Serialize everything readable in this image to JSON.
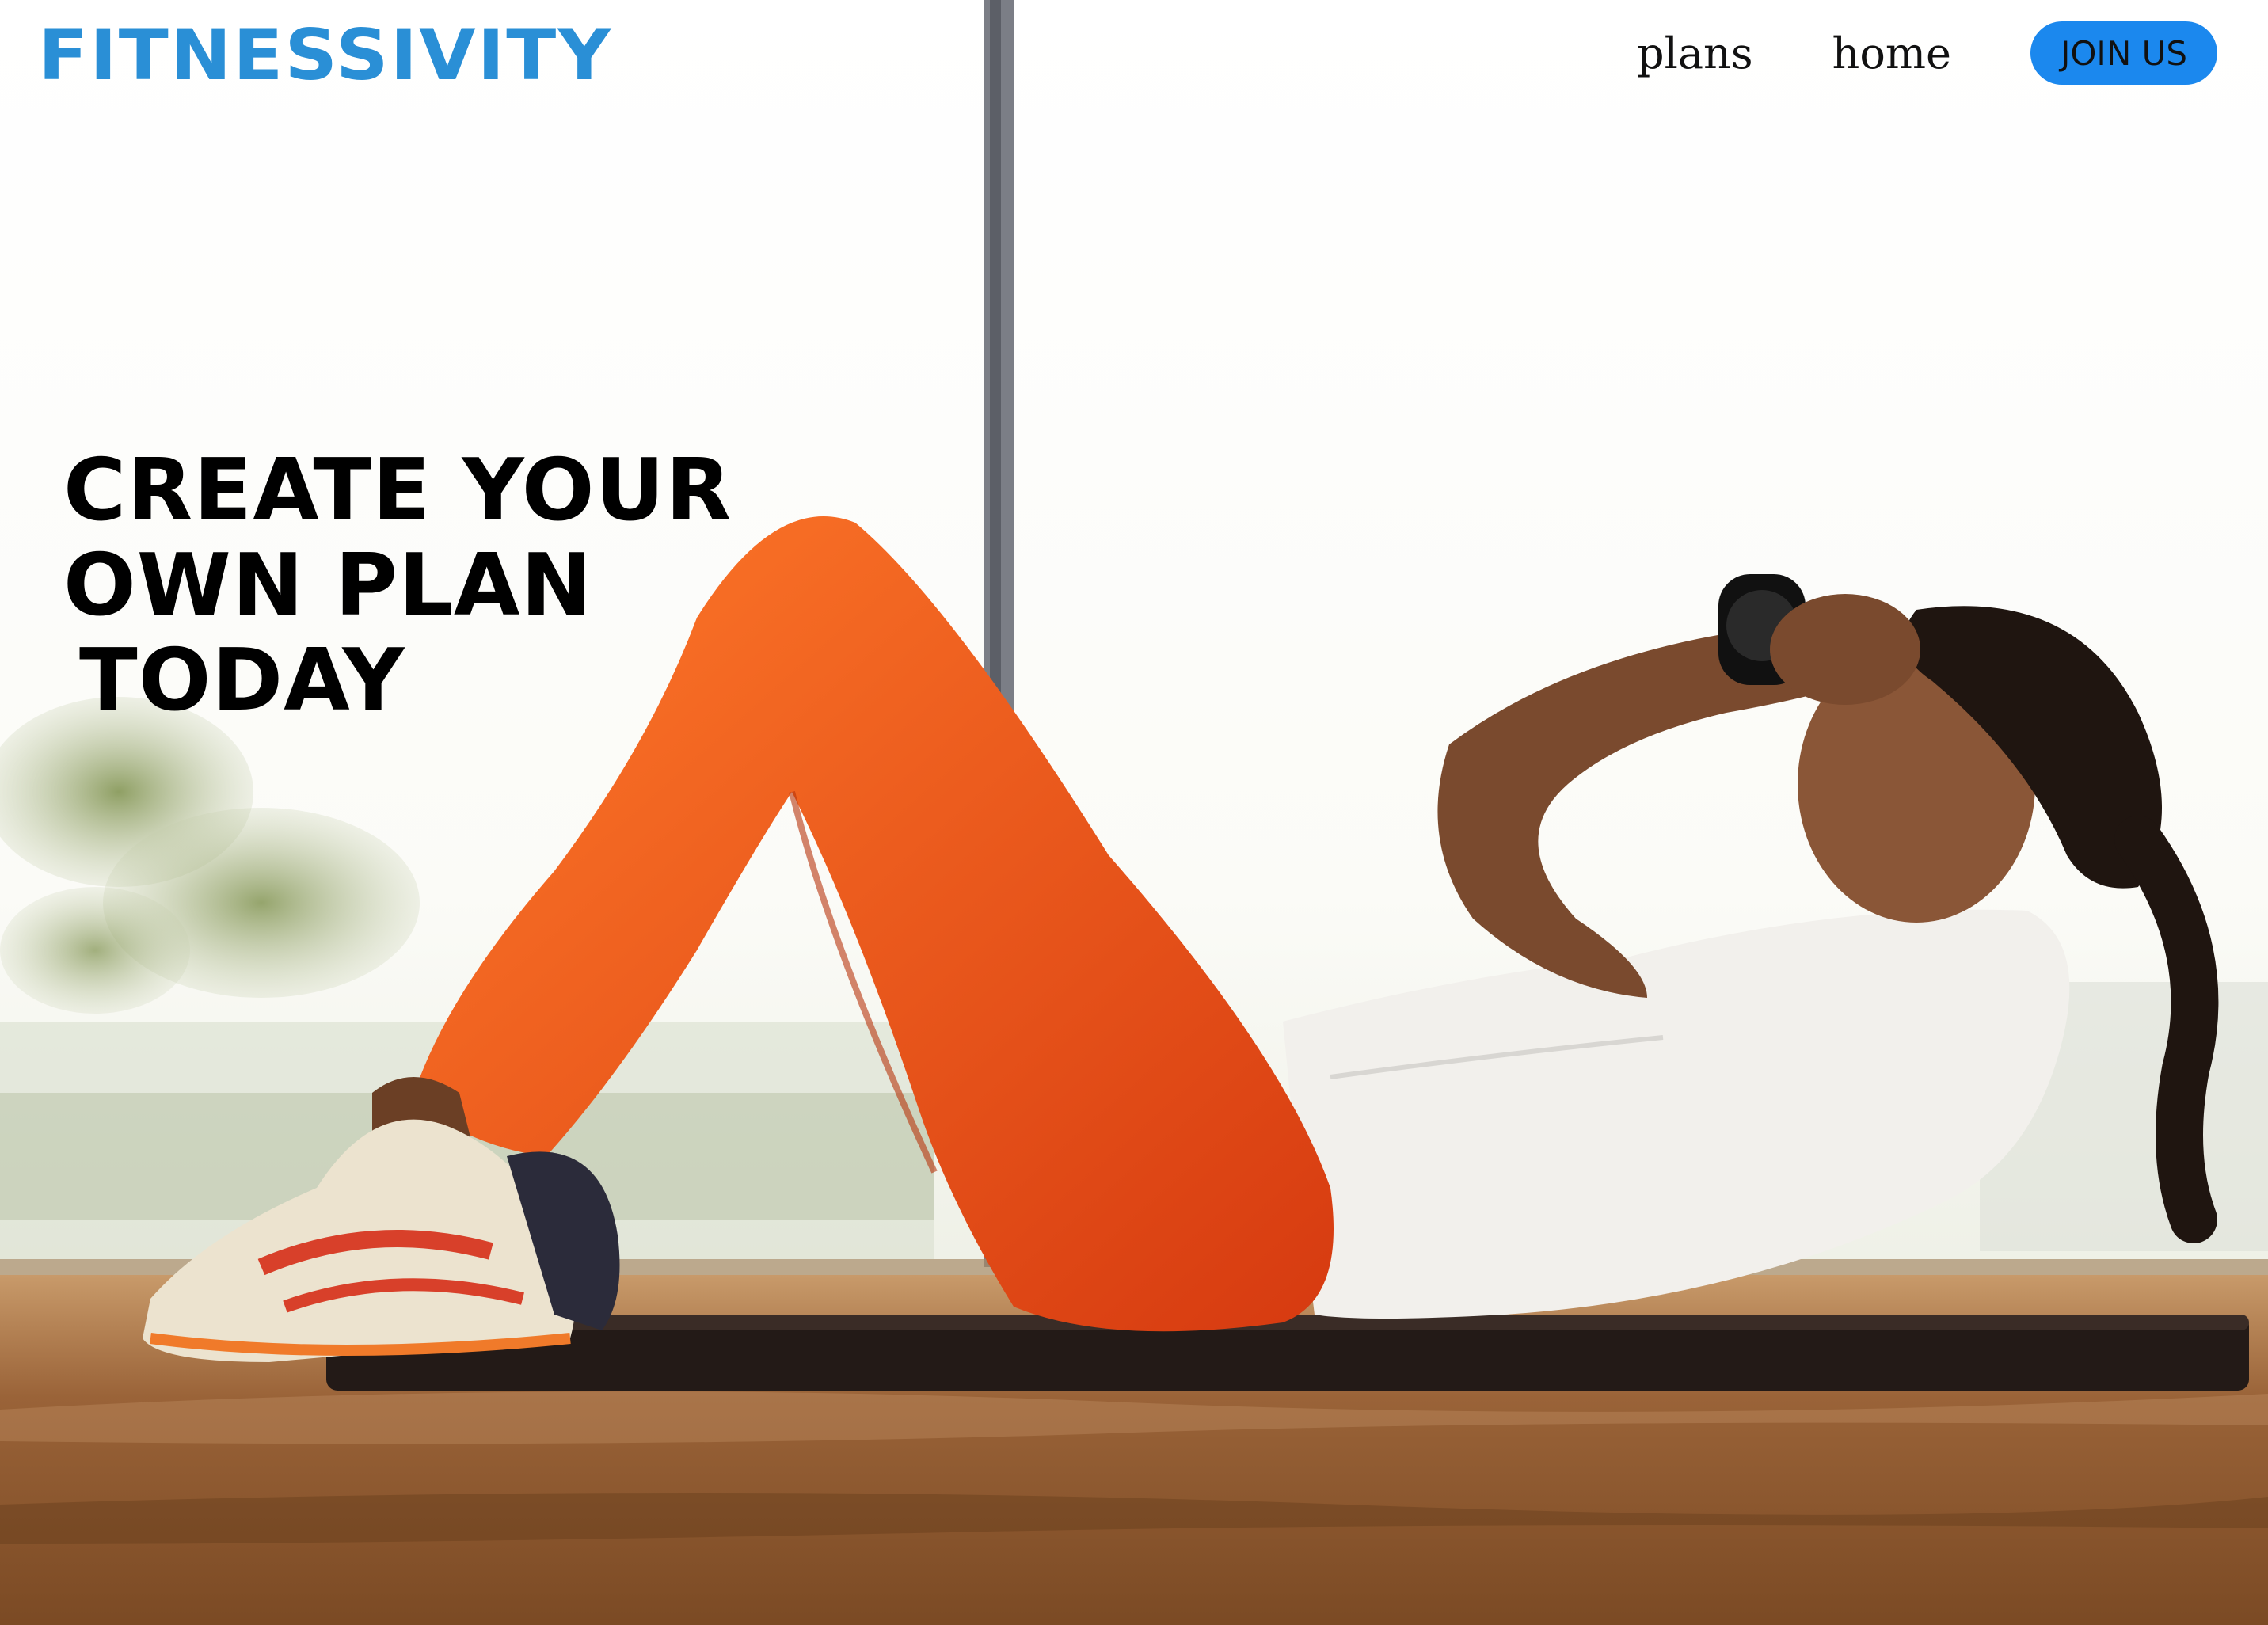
{
  "header": {
    "brand": "Fitnessivity",
    "nav": {
      "plans": "plans",
      "home": "home",
      "join": "JOIN US"
    }
  },
  "hero": {
    "headline": [
      "CREATE YOUR",
      "OWN PLAN",
      "TODAY"
    ]
  },
  "colors": {
    "brand": "#2a8fd6",
    "join_button": "#1b88ee",
    "leggings": "#f05a14",
    "floor": "#8a5a32"
  },
  "icons": {
    "photo": "woman-doing-crunches-photo"
  }
}
